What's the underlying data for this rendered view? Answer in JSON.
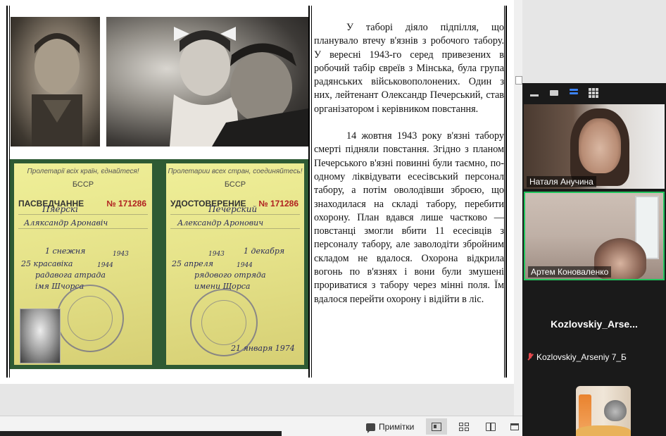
{
  "slide": {
    "documents": {
      "left": {
        "header": "Пролетарії всіх країн, єднайтеся!",
        "republic": "БССР",
        "title": "ПАСВЕДЧАННЕ",
        "number": "№ 171286",
        "name": "Пяёрскі",
        "given_name": "Аляксандр Аронавіч",
        "detachment": "радавога атрада",
        "unit_name": "імя Шчорса",
        "date1": "1 снежня",
        "year1": "1943",
        "date2": "25 красавіка",
        "year2": "1944"
      },
      "right": {
        "header": "Пролетарии всех стран, соединяйтесь!",
        "republic": "БССР",
        "title": "УДОСТОВЕРЕНИЕ",
        "number": "№ 171286",
        "name": "Печерский",
        "given_name": "Александр Аронович",
        "detachment": "рядового отряда",
        "unit_name": "имени Щорса",
        "date1": "1 декабря",
        "year1": "1943",
        "date2": "25 апреля",
        "year2": "1944",
        "signed": "21 января 1974"
      }
    },
    "paragraph1": "У таборі діяло підпілля, що планувало втечу в'язнів з робочого табору. У вересні 1943-го серед привезених в робочий табір євреїв з Мінська, була група радянських військовополонених. Один з них, лейтенант Олександр Печерський, став організатором і керівником повстання.",
    "paragraph2": "14 жовтня 1943 року в'язні табору смерті підняли повстання. Згідно з планом Печерського в'язні повинні були таємно, по-одному ліквідувати есесівський персонал табору, а потім оволодівши зброєю, що знаходилася на складі табору, перебити охорону. План вдався лише частково — повстанці змогли вбити 11 есесівців з персоналу табору, але заволодіти збройним складом не вдалося. Охорона відкрила вогонь по в'язнях і вони були змушені прориватися з табору через мінні поля. Їм вдалося перейти охорону і відійти в ліс."
  },
  "statusbar": {
    "notes_label": "Примітки"
  },
  "zoom": {
    "participants": [
      {
        "name": "Наталя Анучина"
      },
      {
        "name": "Артем Коноваленко"
      },
      {
        "name": "Kozlovskiy_Arse...",
        "label": "Kozlovskiy_Arseniy 7_Б"
      }
    ]
  }
}
